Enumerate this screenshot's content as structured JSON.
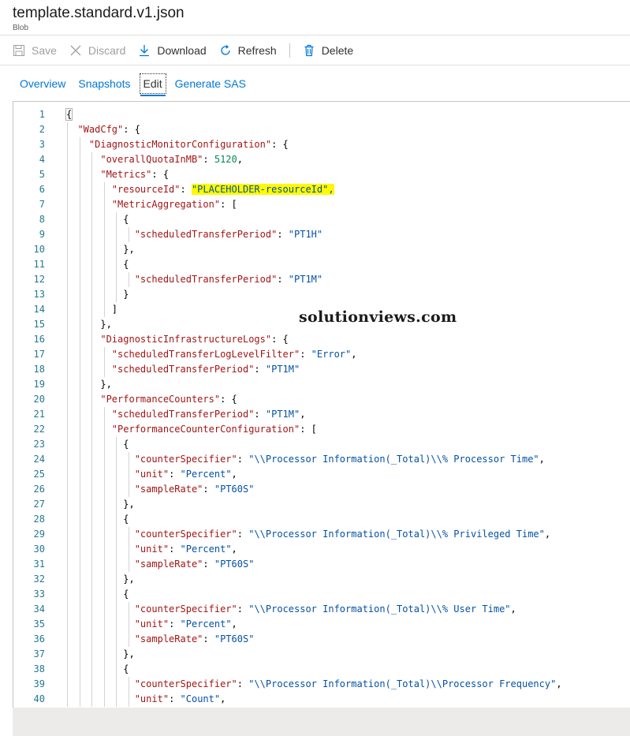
{
  "header": {
    "title": "template.standard.v1.json",
    "subtitle": "Blob"
  },
  "toolbar": {
    "save": "Save",
    "discard": "Discard",
    "download": "Download",
    "refresh": "Refresh",
    "delete": "Delete"
  },
  "tabs": [
    "Overview",
    "Snapshots",
    "Edit",
    "Generate SAS"
  ],
  "active_tab": "Edit",
  "watermark": "solutionviews.com",
  "lines": [
    {
      "n": "1",
      "parts": [
        {
          "t": "{",
          "c": "cursor"
        }
      ]
    },
    {
      "n": "2",
      "parts": [
        {
          "t": "  "
        },
        {
          "t": "\"WadCfg\"",
          "c": "key"
        },
        {
          "t": ": {"
        }
      ]
    },
    {
      "n": "3",
      "parts": [
        {
          "t": "    "
        },
        {
          "t": "\"DiagnosticMonitorConfiguration\"",
          "c": "key"
        },
        {
          "t": ": {"
        }
      ]
    },
    {
      "n": "4",
      "parts": [
        {
          "t": "      "
        },
        {
          "t": "\"overallQuotaInMB\"",
          "c": "key"
        },
        {
          "t": ": "
        },
        {
          "t": "5120",
          "c": "num"
        },
        {
          "t": ","
        }
      ]
    },
    {
      "n": "5",
      "parts": [
        {
          "t": "      "
        },
        {
          "t": "\"Metrics\"",
          "c": "key"
        },
        {
          "t": ": {"
        }
      ]
    },
    {
      "n": "6",
      "parts": [
        {
          "t": "        "
        },
        {
          "t": "\"resourceId\"",
          "c": "key"
        },
        {
          "t": ": "
        },
        {
          "t": "\"PLACEHOLDER-resourceId\",",
          "c": "str hl"
        }
      ]
    },
    {
      "n": "7",
      "parts": [
        {
          "t": "        "
        },
        {
          "t": "\"MetricAggregation\"",
          "c": "key"
        },
        {
          "t": ": ["
        }
      ]
    },
    {
      "n": "8",
      "parts": [
        {
          "t": "          {"
        }
      ]
    },
    {
      "n": "9",
      "parts": [
        {
          "t": "            "
        },
        {
          "t": "\"scheduledTransferPeriod\"",
          "c": "key"
        },
        {
          "t": ": "
        },
        {
          "t": "\"PT1H\"",
          "c": "str"
        }
      ]
    },
    {
      "n": "10",
      "parts": [
        {
          "t": "          },"
        }
      ]
    },
    {
      "n": "11",
      "parts": [
        {
          "t": "          {"
        }
      ]
    },
    {
      "n": "12",
      "parts": [
        {
          "t": "            "
        },
        {
          "t": "\"scheduledTransferPeriod\"",
          "c": "key"
        },
        {
          "t": ": "
        },
        {
          "t": "\"PT1M\"",
          "c": "str"
        }
      ]
    },
    {
      "n": "13",
      "parts": [
        {
          "t": "          }"
        }
      ]
    },
    {
      "n": "14",
      "parts": [
        {
          "t": "        ]"
        }
      ]
    },
    {
      "n": "15",
      "parts": [
        {
          "t": "      },"
        }
      ]
    },
    {
      "n": "16",
      "parts": [
        {
          "t": "      "
        },
        {
          "t": "\"DiagnosticInfrastructureLogs\"",
          "c": "key"
        },
        {
          "t": ": {"
        }
      ]
    },
    {
      "n": "17",
      "parts": [
        {
          "t": "        "
        },
        {
          "t": "\"scheduledTransferLogLevelFilter\"",
          "c": "key"
        },
        {
          "t": ": "
        },
        {
          "t": "\"Error\"",
          "c": "str"
        },
        {
          "t": ","
        }
      ]
    },
    {
      "n": "18",
      "parts": [
        {
          "t": "        "
        },
        {
          "t": "\"scheduledTransferPeriod\"",
          "c": "key"
        },
        {
          "t": ": "
        },
        {
          "t": "\"PT1M\"",
          "c": "str"
        }
      ]
    },
    {
      "n": "19",
      "parts": [
        {
          "t": "      },"
        }
      ]
    },
    {
      "n": "20",
      "parts": [
        {
          "t": "      "
        },
        {
          "t": "\"PerformanceCounters\"",
          "c": "key"
        },
        {
          "t": ": {"
        }
      ]
    },
    {
      "n": "21",
      "parts": [
        {
          "t": "        "
        },
        {
          "t": "\"scheduledTransferPeriod\"",
          "c": "key"
        },
        {
          "t": ": "
        },
        {
          "t": "\"PT1M\"",
          "c": "str"
        },
        {
          "t": ","
        }
      ]
    },
    {
      "n": "22",
      "parts": [
        {
          "t": "        "
        },
        {
          "t": "\"PerformanceCounterConfiguration\"",
          "c": "key"
        },
        {
          "t": ": ["
        }
      ]
    },
    {
      "n": "23",
      "parts": [
        {
          "t": "          {"
        }
      ]
    },
    {
      "n": "24",
      "parts": [
        {
          "t": "            "
        },
        {
          "t": "\"counterSpecifier\"",
          "c": "key"
        },
        {
          "t": ": "
        },
        {
          "t": "\"\\\\Processor Information(_Total)\\\\% Processor Time\"",
          "c": "str"
        },
        {
          "t": ","
        }
      ]
    },
    {
      "n": "25",
      "parts": [
        {
          "t": "            "
        },
        {
          "t": "\"unit\"",
          "c": "key"
        },
        {
          "t": ": "
        },
        {
          "t": "\"Percent\"",
          "c": "str"
        },
        {
          "t": ","
        }
      ]
    },
    {
      "n": "26",
      "parts": [
        {
          "t": "            "
        },
        {
          "t": "\"sampleRate\"",
          "c": "key"
        },
        {
          "t": ": "
        },
        {
          "t": "\"PT60S\"",
          "c": "str"
        }
      ]
    },
    {
      "n": "27",
      "parts": [
        {
          "t": "          },"
        }
      ]
    },
    {
      "n": "28",
      "parts": [
        {
          "t": "          {"
        }
      ]
    },
    {
      "n": "29",
      "parts": [
        {
          "t": "            "
        },
        {
          "t": "\"counterSpecifier\"",
          "c": "key"
        },
        {
          "t": ": "
        },
        {
          "t": "\"\\\\Processor Information(_Total)\\\\% Privileged Time\"",
          "c": "str"
        },
        {
          "t": ","
        }
      ]
    },
    {
      "n": "30",
      "parts": [
        {
          "t": "            "
        },
        {
          "t": "\"unit\"",
          "c": "key"
        },
        {
          "t": ": "
        },
        {
          "t": "\"Percent\"",
          "c": "str"
        },
        {
          "t": ","
        }
      ]
    },
    {
      "n": "31",
      "parts": [
        {
          "t": "            "
        },
        {
          "t": "\"sampleRate\"",
          "c": "key"
        },
        {
          "t": ": "
        },
        {
          "t": "\"PT60S\"",
          "c": "str"
        }
      ]
    },
    {
      "n": "32",
      "parts": [
        {
          "t": "          },"
        }
      ]
    },
    {
      "n": "33",
      "parts": [
        {
          "t": "          {"
        }
      ]
    },
    {
      "n": "34",
      "parts": [
        {
          "t": "            "
        },
        {
          "t": "\"counterSpecifier\"",
          "c": "key"
        },
        {
          "t": ": "
        },
        {
          "t": "\"\\\\Processor Information(_Total)\\\\% User Time\"",
          "c": "str"
        },
        {
          "t": ","
        }
      ]
    },
    {
      "n": "35",
      "parts": [
        {
          "t": "            "
        },
        {
          "t": "\"unit\"",
          "c": "key"
        },
        {
          "t": ": "
        },
        {
          "t": "\"Percent\"",
          "c": "str"
        },
        {
          "t": ","
        }
      ]
    },
    {
      "n": "36",
      "parts": [
        {
          "t": "            "
        },
        {
          "t": "\"sampleRate\"",
          "c": "key"
        },
        {
          "t": ": "
        },
        {
          "t": "\"PT60S\"",
          "c": "str"
        }
      ]
    },
    {
      "n": "37",
      "parts": [
        {
          "t": "          },"
        }
      ]
    },
    {
      "n": "38",
      "parts": [
        {
          "t": "          {"
        }
      ]
    },
    {
      "n": "39",
      "parts": [
        {
          "t": "            "
        },
        {
          "t": "\"counterSpecifier\"",
          "c": "key"
        },
        {
          "t": ": "
        },
        {
          "t": "\"\\\\Processor Information(_Total)\\\\Processor Frequency\"",
          "c": "str"
        },
        {
          "t": ","
        }
      ]
    },
    {
      "n": "40",
      "parts": [
        {
          "t": "            "
        },
        {
          "t": "\"unit\"",
          "c": "key"
        },
        {
          "t": ": "
        },
        {
          "t": "\"Count\"",
          "c": "str"
        },
        {
          "t": ","
        }
      ]
    }
  ],
  "colors": {
    "accent": "#0078d4",
    "highlight": "#fffa00",
    "key": "#a31515",
    "string": "#0451a5",
    "number": "#098658",
    "line_number": "#237893"
  }
}
